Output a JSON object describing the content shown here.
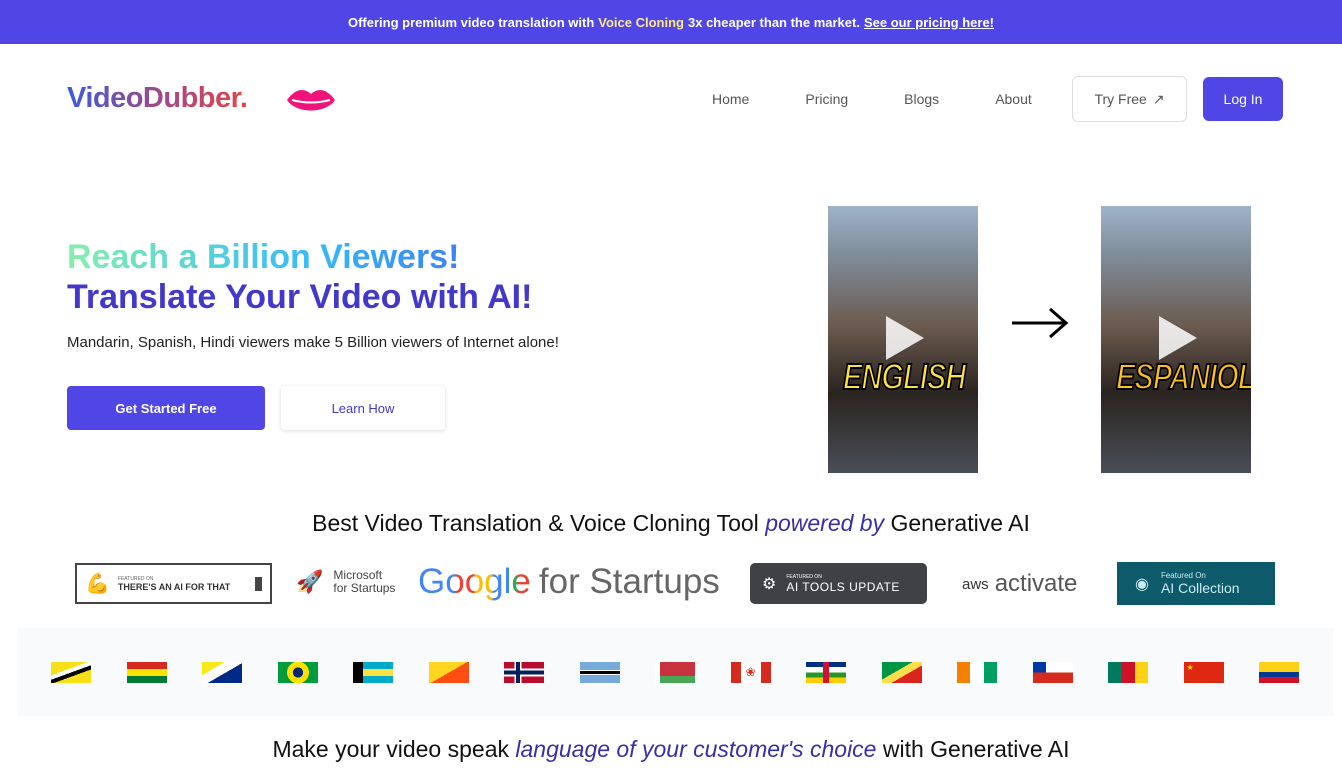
{
  "banner": {
    "pre": "Offering premium video translation with",
    "highlight": "Voice Cloning",
    "post": "3x cheaper than the market.",
    "link": "See our pricing here!"
  },
  "nav": {
    "logo": "VideoDubber.",
    "links": [
      "Home",
      "Pricing",
      "Blogs",
      "About"
    ],
    "try_free": "Try Free",
    "login": "Log In"
  },
  "hero": {
    "headline1": "Reach a Billion Viewers!",
    "headline2": "Translate Your Video with AI!",
    "subtitle": "Mandarin, Spanish, Hindi viewers make 5 Billion viewers of Internet alone!",
    "cta_primary": "Get Started Free",
    "cta_secondary": "Learn How",
    "video_before_caption": "ENGLISH",
    "video_after_caption": "ESPANIOL"
  },
  "tagline": {
    "pre": "Best Video Translation & Voice Cloning Tool",
    "em": "powered by",
    "post": "Generative AI"
  },
  "partners": {
    "taaft_small": "FEATURED ON",
    "taaft": "THERE'S AN AI FOR THAT",
    "ms1": "Microsoft",
    "ms2": "for Startups",
    "google": "Google",
    "google_post": "for Startups",
    "aitu_small": "FEATURED ON",
    "aitu": "AI TOOLS UPDATE",
    "aws": "aws",
    "aws_post": "activate",
    "aic_small": "Featured On",
    "aic": "AI Collection"
  },
  "flags": [
    "brunei",
    "bolivia",
    "bonaire",
    "brazil",
    "bahamas",
    "bhutan",
    "norway",
    "botswana",
    "belarus",
    "canada",
    "central-african-republic",
    "congo",
    "ivory-coast",
    "chile",
    "cameroon",
    "china",
    "colombia"
  ],
  "bottom": {
    "pre": "Make your video speak",
    "em": "language of your customer's choice",
    "post": "with Generative AI"
  },
  "colors": {
    "accent": "#4f46e5",
    "heading": "#4338ca"
  }
}
